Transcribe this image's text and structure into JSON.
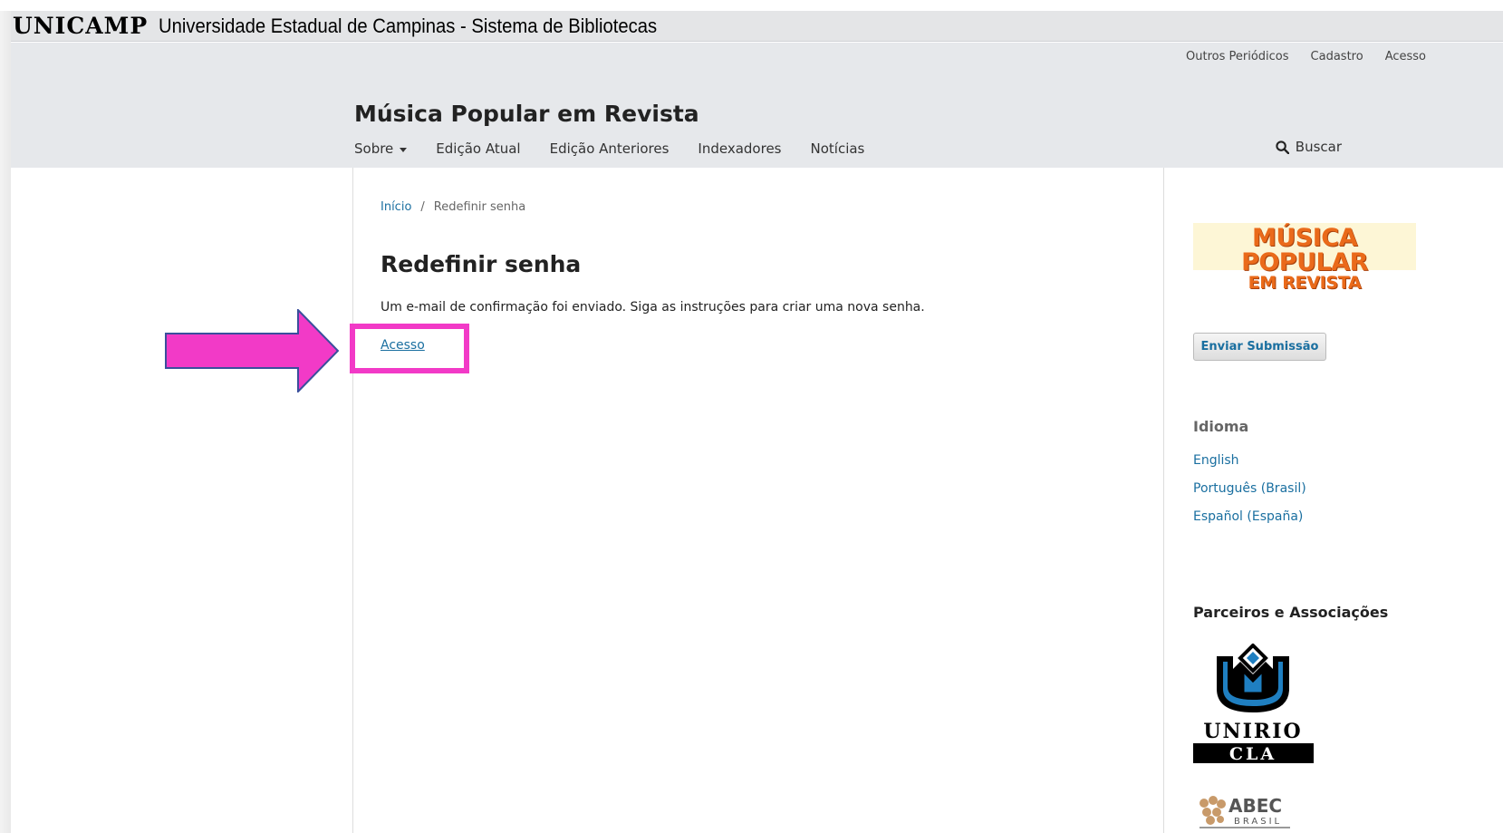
{
  "banner": {
    "logo": "UNICAMP",
    "text": "Universidade Estadual de Campinas - Sistema de Bibliotecas"
  },
  "user_nav": [
    "Outros Periódicos",
    "Cadastro",
    "Acesso"
  ],
  "site": {
    "title": "Música Popular em Revista",
    "nav": [
      "Sobre",
      "Edição Atual",
      "Edição Anteriores",
      "Indexadores",
      "Notícias"
    ],
    "search_label": "Buscar"
  },
  "breadcrumb": {
    "home": "Início",
    "separator": "/",
    "current": "Redefinir senha"
  },
  "main": {
    "title": "Redefinir senha",
    "message": "Um e-mail de confirmação foi enviado. Siga as instruções para criar uma nova senha.",
    "login_link": "Acesso"
  },
  "sidebar": {
    "journal_logo": {
      "line1": "MÚSICA POPULAR",
      "line2": "EM REVISTA"
    },
    "submit_button": "Enviar Submissão",
    "language_title": "Idioma",
    "languages": [
      "English",
      "Português (Brasil)",
      "Español (España)"
    ],
    "partners_title": "Parceiros e Associações",
    "partner_logos": {
      "unirio": {
        "name": "UNIRIO",
        "sub": "CLA"
      },
      "abec": {
        "name": "ABEC",
        "sub": "BRASIL"
      }
    }
  },
  "colors": {
    "link": "#1a6fa0",
    "header_bg": "#e6e8eb",
    "highlight": "#f23ac7",
    "logo_orange": "#ea6a1a",
    "unirio_blue": "#1f7fc1"
  }
}
